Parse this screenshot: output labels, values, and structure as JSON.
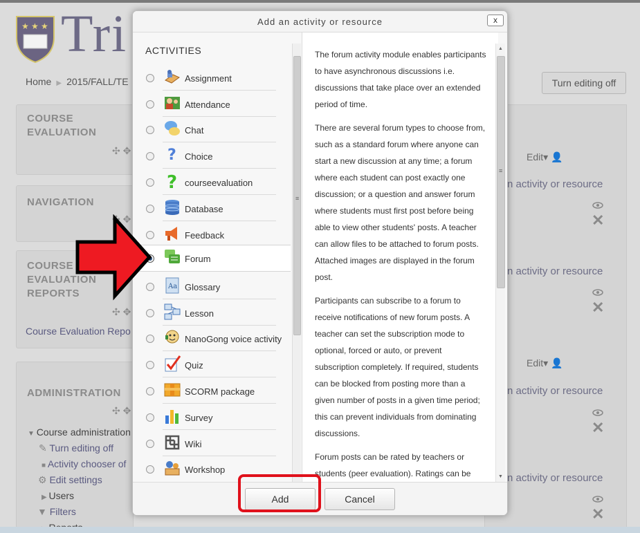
{
  "page": {
    "logo_text": "Tri",
    "breadcrumb": [
      "Home",
      "2015/FALL/TE"
    ],
    "turn_editing_off_button": "Turn editing off",
    "blocks": {
      "course_evaluation": [
        "COURSE",
        "EVALUATION"
      ],
      "navigation": "NAVIGATION",
      "course_evaluation_reports": [
        "COURSE",
        "EVALUATION",
        "REPORTS"
      ],
      "course_evaluation_report_link": "Course Evaluation Repo",
      "administration": "ADMINISTRATION",
      "admin_items": {
        "course_administration": "Course administration",
        "turn_editing_off": "Turn editing off",
        "activity_chooser": "Activity chooser of",
        "edit_settings": "Edit settings",
        "users": "Users",
        "filters": "Filters",
        "reports": "Reports"
      }
    },
    "main": {
      "edit_label": "Edit",
      "add_activity_link": "n activity or resource"
    }
  },
  "dialog": {
    "title": "Add an activity or resource",
    "close_label": "x",
    "section_label": "ACTIVITIES",
    "selected": "Forum",
    "activities": [
      {
        "label": "Assignment",
        "icon": "assignment-icon"
      },
      {
        "label": "Attendance",
        "icon": "attendance-icon"
      },
      {
        "label": "Chat",
        "icon": "chat-icon"
      },
      {
        "label": "Choice",
        "icon": "choice-icon"
      },
      {
        "label": "courseevaluation",
        "icon": "courseevaluation-icon"
      },
      {
        "label": "Database",
        "icon": "database-icon"
      },
      {
        "label": "Feedback",
        "icon": "feedback-icon"
      },
      {
        "label": "Forum",
        "icon": "forum-icon"
      },
      {
        "label": "Glossary",
        "icon": "glossary-icon"
      },
      {
        "label": "Lesson",
        "icon": "lesson-icon"
      },
      {
        "label": "NanoGong voice activity",
        "icon": "nanogong-icon"
      },
      {
        "label": "Quiz",
        "icon": "quiz-icon"
      },
      {
        "label": "SCORM package",
        "icon": "scorm-icon"
      },
      {
        "label": "Survey",
        "icon": "survey-icon"
      },
      {
        "label": "Wiki",
        "icon": "wiki-icon"
      },
      {
        "label": "Workshop",
        "icon": "workshop-icon"
      }
    ],
    "description": [
      "The forum activity module enables participants to have asynchronous discussions i.e. discussions that take place over an extended period of time.",
      "There are several forum types to choose from, such as a standard forum where anyone can start a new discussion at any time; a forum where each student can post exactly one discussion; or a question and answer forum where students must first post before being able to view other students' posts. A teacher can allow files to be attached to forum posts. Attached images are displayed in the forum post.",
      "Participants can subscribe to a forum to receive notifications of new forum posts. A teacher can set the subscription mode to optional, forced or auto, or prevent subscription completely. If required, students can be blocked from posting more than a given number of posts in a given time period; this can prevent individuals from dominating discussions.",
      "Forum posts can be rated by teachers or students (peer evaluation). Ratings can be"
    ],
    "add_button": "Add",
    "cancel_button": "Cancel"
  },
  "colors": {
    "annotation_red": "#e0111b",
    "forum_selected_bg": "#ffffff",
    "dialog_bg": "#f7f7f7"
  }
}
